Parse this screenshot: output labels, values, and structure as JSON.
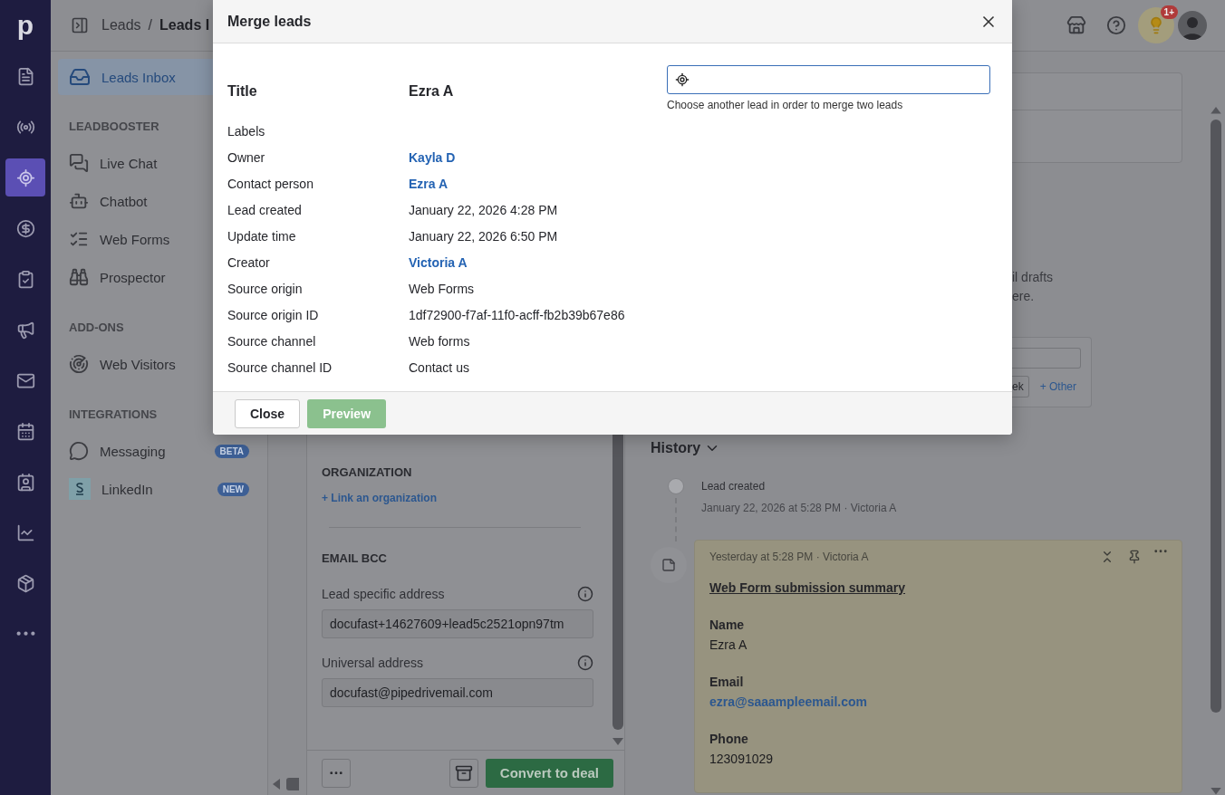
{
  "rail": {
    "logo": "p",
    "items": [
      {
        "selected": false
      },
      {
        "selected": false
      },
      {
        "selected": true
      },
      {
        "selected": false
      },
      {
        "selected": false
      },
      {
        "selected": false
      },
      {
        "selected": false
      },
      {
        "selected": false
      },
      {
        "selected": false
      },
      {
        "selected": false
      },
      {
        "selected": false
      },
      {
        "selected": false
      }
    ]
  },
  "topbar": {
    "breadcrumb": [
      "Leads",
      "/",
      "Leads I"
    ],
    "notification_badge": "1+"
  },
  "sidebar": {
    "top_items": [
      {
        "label": "Leads Inbox",
        "selected": true
      }
    ],
    "sections": [
      {
        "heading": "LEADBOOSTER",
        "items": [
          {
            "label": "Live Chat",
            "selected": false
          },
          {
            "label": "Chatbot",
            "selected": false
          },
          {
            "label": "Web Forms",
            "selected": false
          },
          {
            "label": "Prospector",
            "selected": false
          }
        ]
      },
      {
        "heading": "ADD-ONS",
        "items": [
          {
            "label": "Web Visitors",
            "selected": false
          }
        ]
      },
      {
        "heading": "INTEGRATIONS",
        "items": [
          {
            "label": "Messaging",
            "selected": false,
            "badge": "BETA"
          },
          {
            "label": "LinkedIn",
            "selected": false,
            "badge": "NEW"
          }
        ]
      }
    ]
  },
  "lead_panel": {
    "organization_heading": "ORGANIZATION",
    "link_organization": "+ Link an organization",
    "email_bcc_heading": "EMAIL BCC",
    "fields": [
      {
        "label": "Lead specific address",
        "value": "docufast+14627609+lead5c2521opn97tm"
      },
      {
        "label": "Universal address",
        "value": "docufast@pipedrivemail.com"
      }
    ],
    "convert_button": "Convert to deal"
  },
  "right_panel": {
    "text_fragments": [
      "il drafts",
      "ere."
    ],
    "schedule_card": {
      "button": "ek",
      "other_link": "+ Other"
    },
    "history": {
      "title": "History",
      "events": [
        {
          "title": "Lead created",
          "meta": "January 22, 2026 at 5:28 PM · Victoria A"
        }
      ],
      "note": {
        "meta": "Yesterday at 5:28 PM · Victoria A",
        "heading": "Web Form submission summary",
        "fields": [
          {
            "label": "Name",
            "value": "Ezra A",
            "kind": "text"
          },
          {
            "label": "Email",
            "value": "ezra@saaampleemail.com",
            "kind": "link"
          },
          {
            "label": "Phone",
            "value": "123091029",
            "kind": "text"
          }
        ]
      }
    }
  },
  "modal": {
    "title": "Merge leads",
    "title_row": {
      "label": "Title",
      "value": "Ezra A"
    },
    "rows": [
      {
        "label": "Labels"
      },
      {
        "label": "Owner",
        "value": "Kayla D",
        "kind": "link"
      },
      {
        "label": "Contact person",
        "value": "Ezra A",
        "kind": "link"
      },
      {
        "label": "Lead created",
        "value": "January 22, 2026 4:28 PM",
        "kind": "text"
      },
      {
        "label": "Update time",
        "value": "January 22, 2026 6:50 PM",
        "kind": "text"
      },
      {
        "label": "Creator",
        "value": "Victoria A",
        "kind": "link"
      },
      {
        "label": "Source origin",
        "value": "Web Forms",
        "kind": "text"
      },
      {
        "label": "Source origin ID",
        "value": "1df72900-f7af-11f0-acff-fb2b39b67e86",
        "kind": "text"
      },
      {
        "label": "Source channel",
        "value": "Web forms",
        "kind": "text"
      },
      {
        "label": "Source channel ID",
        "value": "Contact us",
        "kind": "text"
      }
    ],
    "search": {
      "helper": "Choose another lead in order to merge two leads"
    },
    "buttons": [
      {
        "label": "Close",
        "kind": "secondary",
        "disabled": false
      },
      {
        "label": "Preview",
        "kind": "primary",
        "disabled": true
      }
    ]
  }
}
